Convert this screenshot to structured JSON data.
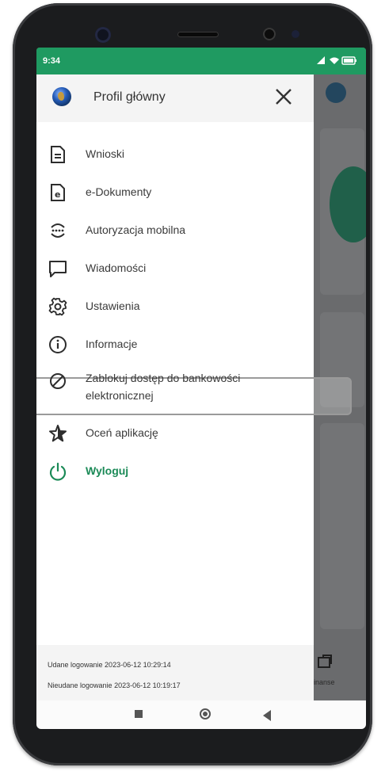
{
  "status_bar": {
    "time": "9:34",
    "icons_text": "⫼ ⌔ ▭"
  },
  "drawer": {
    "profile_name": "Profil główny",
    "menu": [
      {
        "label": "Wnioski",
        "icon": "document-icon"
      },
      {
        "label": "e-Dokumenty",
        "icon": "e-document-icon"
      },
      {
        "label": "Autoryzacja mobilna",
        "icon": "mobile-authorization-icon"
      },
      {
        "label": "Wiadomości",
        "icon": "message-icon"
      },
      {
        "label": "Ustawienia",
        "icon": "gear-icon"
      },
      {
        "label": "Informacje",
        "icon": "info-icon"
      },
      {
        "label": "Zablokuj dostęp do bankowości elektronicznej",
        "icon": "block-icon"
      },
      {
        "label": "Oceń aplikację",
        "icon": "star-icon"
      },
      {
        "label": "Wyloguj",
        "icon": "power-icon"
      }
    ],
    "footer": {
      "last_success": "Udane logowanie 2023-06-12 10:29:14",
      "last_failed": "Nieudane logowanie 2023-06-12 10:19:17"
    }
  },
  "background_app": {
    "bottom_tab_label": "inanse"
  },
  "colors": {
    "accent_green": "#1f9a61",
    "logout_green": "#1b8a57",
    "overlay": "#6b6c6e"
  }
}
